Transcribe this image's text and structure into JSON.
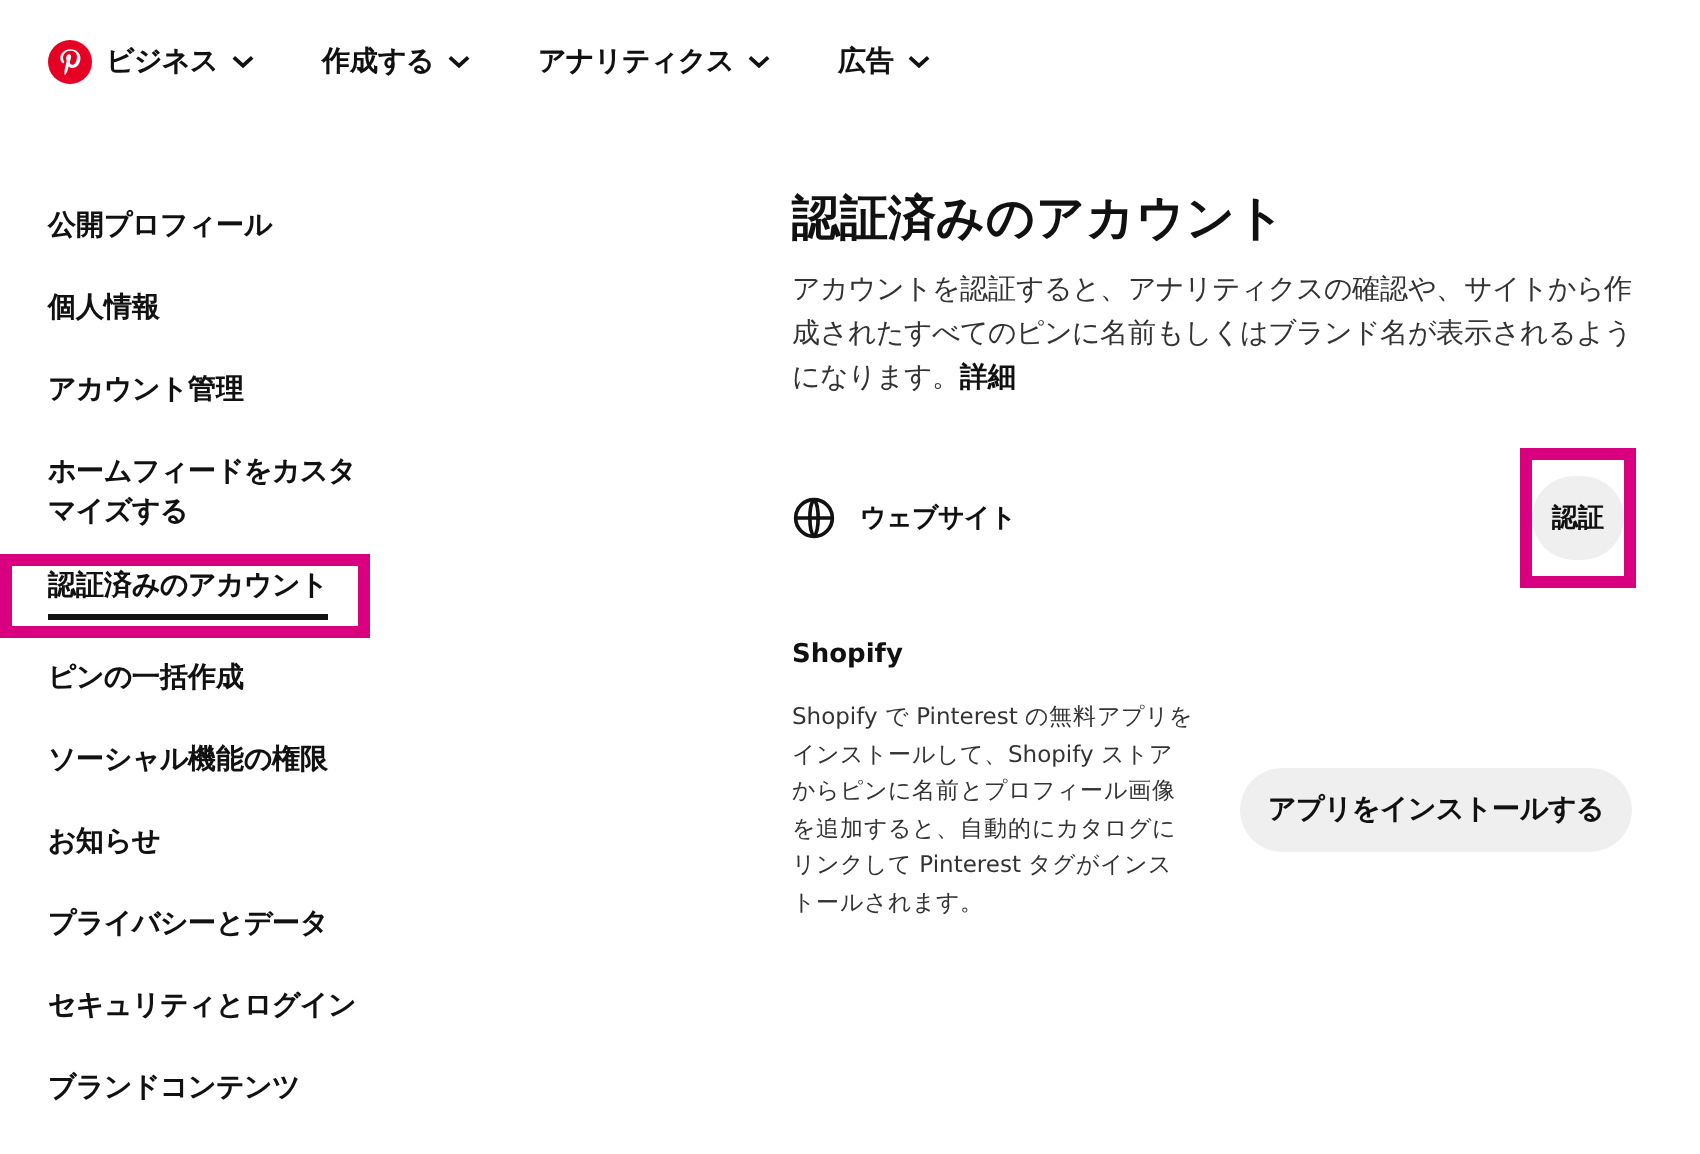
{
  "nav": [
    {
      "label": "ビジネス",
      "logo": true
    },
    {
      "label": "作成する",
      "logo": false
    },
    {
      "label": "アナリティクス",
      "logo": false
    },
    {
      "label": "広告",
      "logo": false
    }
  ],
  "sidebar": {
    "items": [
      {
        "label": "公開プロフィール",
        "selected": false,
        "highlighted": false
      },
      {
        "label": "個人情報",
        "selected": false,
        "highlighted": false
      },
      {
        "label": "アカウント管理",
        "selected": false,
        "highlighted": false
      },
      {
        "label": "ホームフィードをカスタマイズする",
        "selected": false,
        "highlighted": false
      },
      {
        "label": "認証済みのアカウント",
        "selected": true,
        "highlighted": true
      },
      {
        "label": "ピンの一括作成",
        "selected": false,
        "highlighted": false
      },
      {
        "label": "ソーシャル機能の権限",
        "selected": false,
        "highlighted": false
      },
      {
        "label": "お知らせ",
        "selected": false,
        "highlighted": false
      },
      {
        "label": "プライバシーとデータ",
        "selected": false,
        "highlighted": false
      },
      {
        "label": "セキュリティとログイン",
        "selected": false,
        "highlighted": false
      },
      {
        "label": "ブランドコンテンツ",
        "selected": false,
        "highlighted": false
      }
    ]
  },
  "main": {
    "title": "認証済みのアカウント",
    "description": "アカウントを認証すると、アナリティクスの確認や、サイトから作成されたすべてのピンに名前もしくはブランド名が表示されるようになります。",
    "more_link": "詳細",
    "website": {
      "label": "ウェブサイト",
      "button": "認証",
      "highlighted": true
    },
    "shopify": {
      "title": "Shopify",
      "description": "Shopify で Pinterest の無料アプリをインストールして、Shopify ストアからピンに名前とプロフィール画像を追加すると、自動的にカタログにリンクして Pinterest タグがインストールされます。",
      "button": "アプリをインストールする"
    }
  }
}
